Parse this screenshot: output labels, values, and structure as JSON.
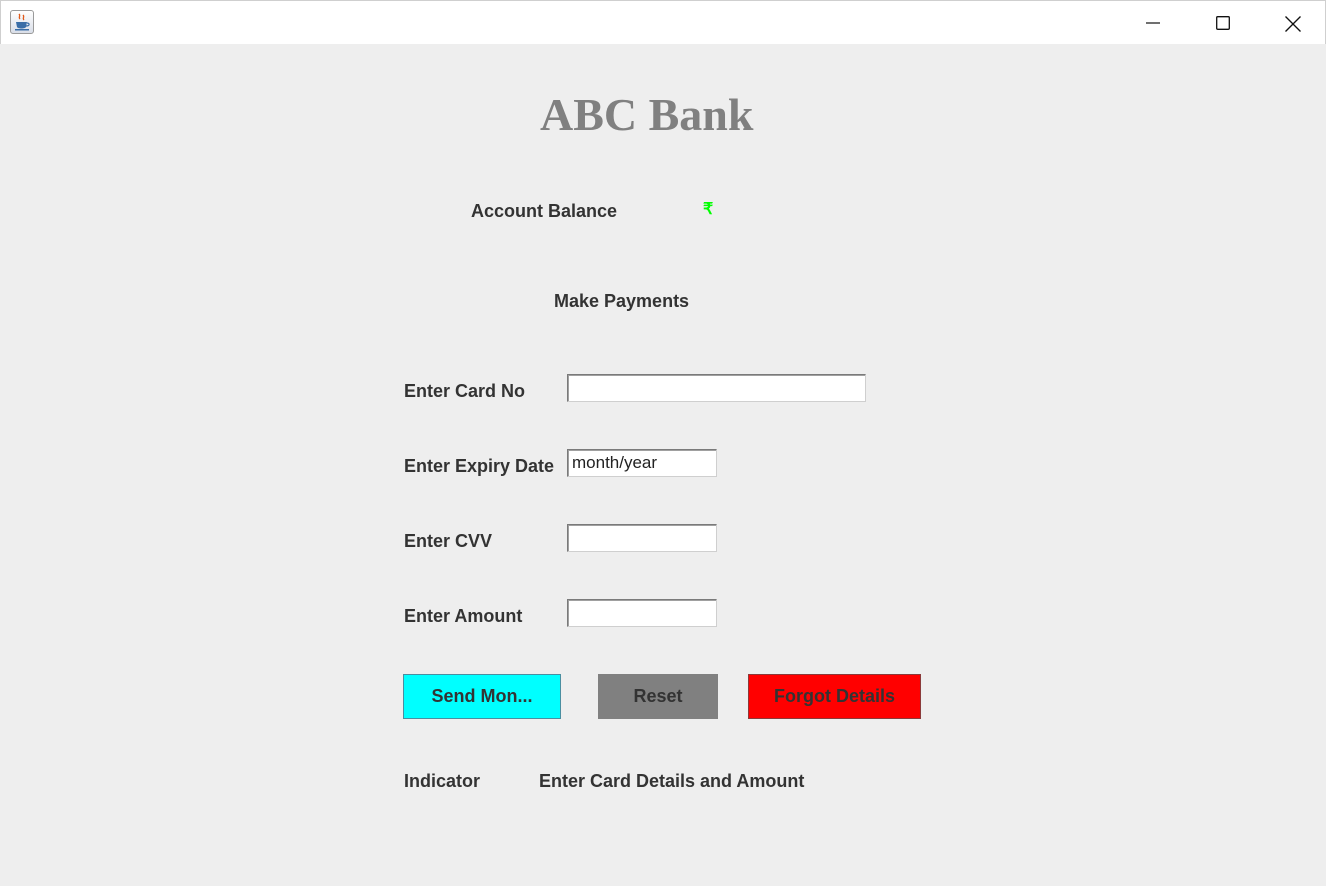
{
  "window": {
    "icon": "java-cup-icon",
    "controls": [
      "minimize-icon",
      "maximize-icon",
      "close-icon"
    ]
  },
  "header": {
    "title": "ABC Bank"
  },
  "balance": {
    "label": "Account Balance",
    "currency_symbol": "₹",
    "currency_color": "#00ff00"
  },
  "section": {
    "title": "Make Payments"
  },
  "form": {
    "card_no": {
      "label": "Enter Card No",
      "value": ""
    },
    "expiry": {
      "label": "Enter Expiry Date",
      "value": "month/year"
    },
    "cvv": {
      "label": "Enter CVV",
      "value": ""
    },
    "amount": {
      "label": "Enter Amount",
      "value": ""
    }
  },
  "buttons": {
    "send": {
      "label": "Send Mon...",
      "color": "#00ffff"
    },
    "reset": {
      "label": "Reset",
      "color": "#808080"
    },
    "forgot": {
      "label": "Forgot Details",
      "color": "#ff0000"
    }
  },
  "status": {
    "label": "Indicator",
    "message": "Enter Card Details and Amount"
  }
}
